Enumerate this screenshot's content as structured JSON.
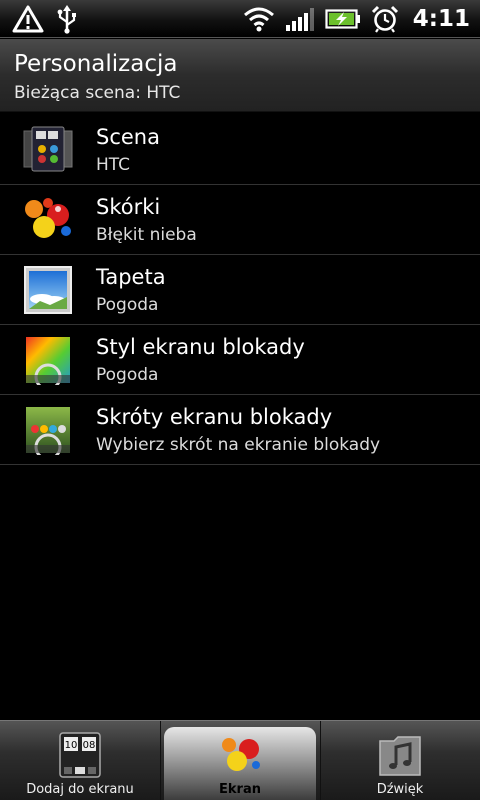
{
  "status_bar": {
    "time": "4:11",
    "icons": [
      "warning-icon",
      "usb-icon",
      "wifi-icon",
      "signal-icon",
      "battery-charging-icon",
      "alarm-icon"
    ]
  },
  "header": {
    "title": "Personalizacja",
    "subtitle": "Bieżąca scena: HTC"
  },
  "list": {
    "items": [
      {
        "title": "Scena",
        "subtitle": "HTC",
        "icon": "scene-icon"
      },
      {
        "title": "Skórki",
        "subtitle": "Błękit nieba",
        "icon": "skins-icon"
      },
      {
        "title": "Tapeta",
        "subtitle": "Pogoda",
        "icon": "wallpaper-icon"
      },
      {
        "title": "Styl ekranu blokady",
        "subtitle": "Pogoda",
        "icon": "lockscreen-style-icon"
      },
      {
        "title": "Skróty ekranu blokady",
        "subtitle": "Wybierz skrót na ekranie blokady",
        "icon": "lockscreen-shortcuts-icon"
      }
    ]
  },
  "tabs": [
    {
      "label": "Dodaj do ekranu",
      "icon": "add-to-home-icon",
      "active": false
    },
    {
      "label": "Ekran",
      "icon": "display-icon",
      "active": true
    },
    {
      "label": "Dźwięk",
      "icon": "sound-icon",
      "active": false
    }
  ]
}
